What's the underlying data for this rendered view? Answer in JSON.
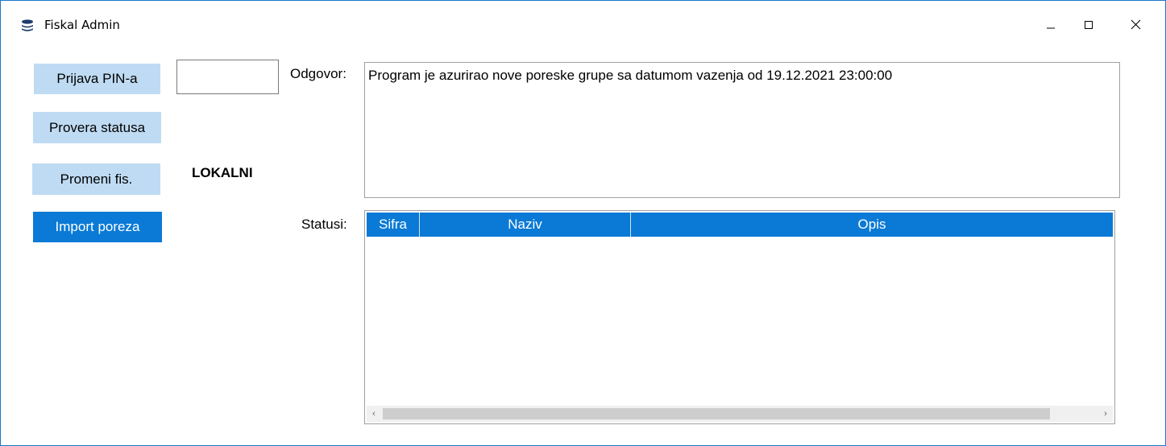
{
  "window": {
    "title": "Fiskal Admin",
    "app_icon": "database-icon",
    "controls": [
      "minimize-icon",
      "maximize-icon",
      "close-icon"
    ]
  },
  "sidebar": {
    "buttons": [
      {
        "label": "Prijava PIN-a",
        "state": "normal"
      },
      {
        "label": "Provera statusa",
        "state": "normal"
      },
      {
        "label": "Promeni fis.",
        "state": "normal"
      },
      {
        "label": "Import poreza",
        "state": "active"
      }
    ],
    "pin_input": {
      "value": "",
      "placeholder": ""
    },
    "mode_label": "LOKALNI"
  },
  "response": {
    "label": "Odgovor:",
    "text": "Program je azurirao nove poreske grupe sa datumom vazenja od 19.12.2021 23:00:00"
  },
  "statuses": {
    "label": "Statusi:",
    "columns": [
      "Sifra",
      "Naziv",
      "Opis"
    ],
    "rows": []
  },
  "colors": {
    "accent": "#0a7ad6",
    "button_bg": "#bfdbf3",
    "window_border": "#1979ca"
  }
}
